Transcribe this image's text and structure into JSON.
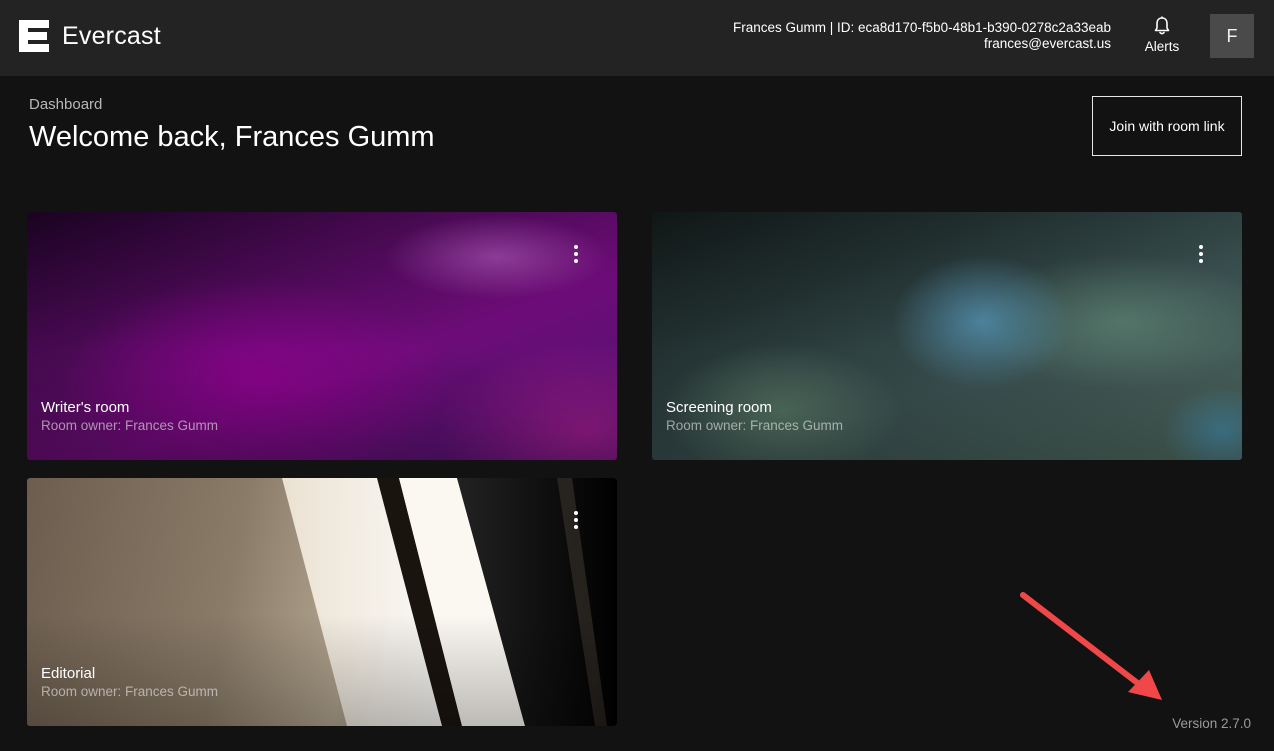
{
  "header": {
    "brand": "Evercast",
    "logo_icon": "evercast-logo-icon",
    "user_line": "Frances Gumm | ID: eca8d170-f5b0-48b1-b390-0278c2a33eab",
    "email": "frances@evercast.us",
    "alerts_label": "Alerts",
    "alerts_icon": "bell-icon",
    "avatar_initial": "F"
  },
  "page": {
    "breadcrumb": "Dashboard",
    "title": "Welcome back, Frances Gumm",
    "join_button": "Join with room link"
  },
  "rooms": [
    {
      "name": "Writer's room",
      "owner": "Room owner: Frances Gumm",
      "menu_icon": "more-vertical-icon"
    },
    {
      "name": "Screening room",
      "owner": "Room owner: Frances Gumm",
      "menu_icon": "more-vertical-icon"
    },
    {
      "name": "Editorial",
      "owner": "Room owner: Frances Gumm",
      "menu_icon": "more-vertical-icon"
    }
  ],
  "footer": {
    "version": "Version 2.7.0"
  },
  "colors": {
    "background": "#121212",
    "topbar": "#232323",
    "annotation_arrow": "#f04848"
  }
}
